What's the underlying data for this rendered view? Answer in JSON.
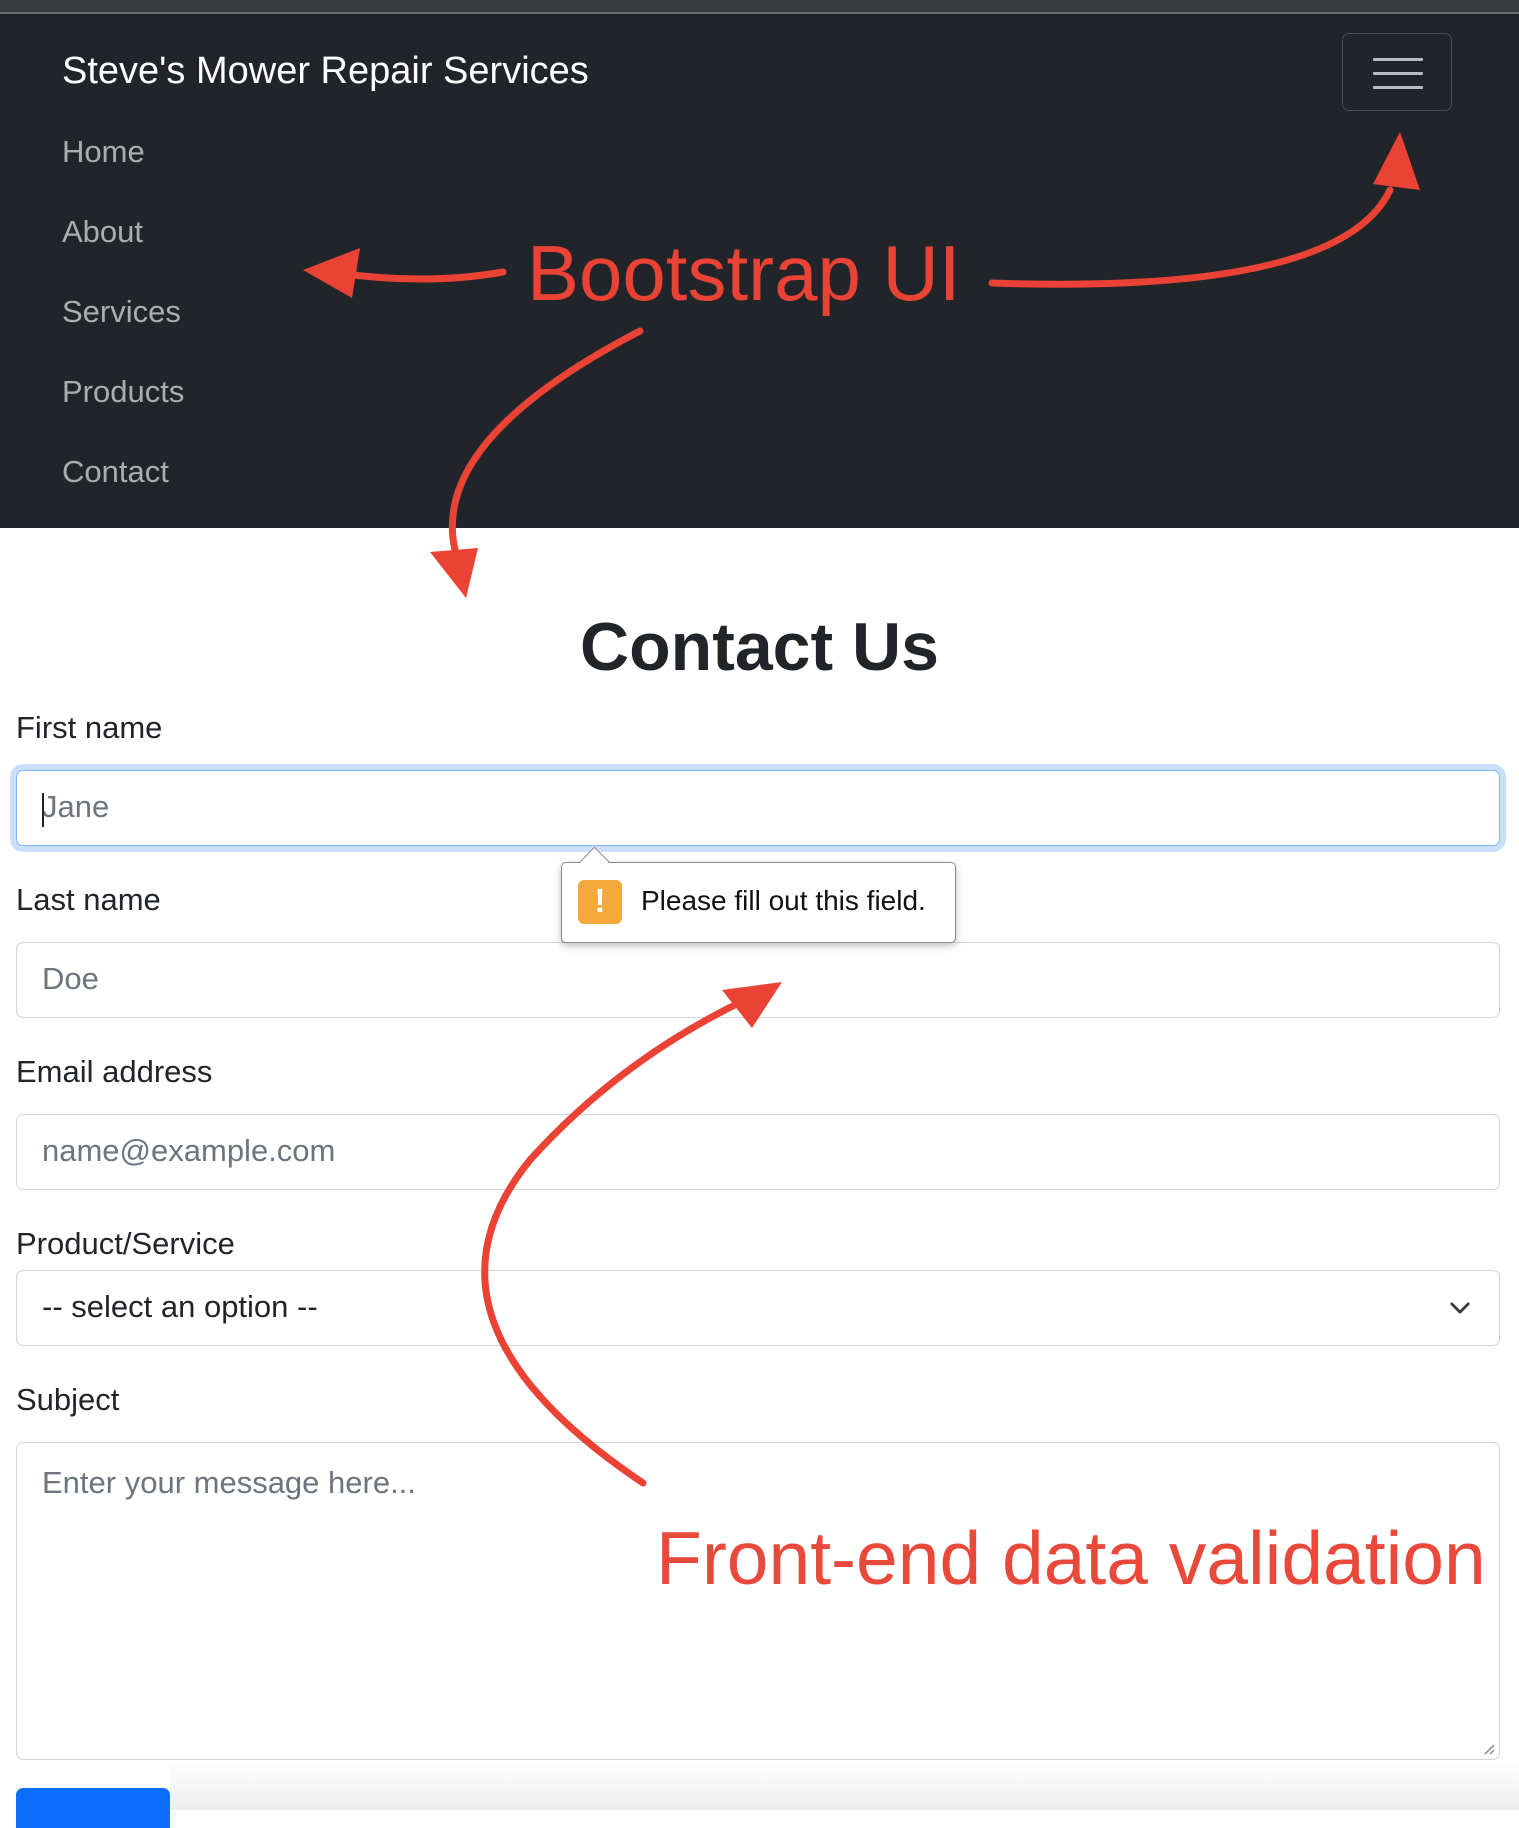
{
  "navbar": {
    "brand": "Steve's Mower Repair Services",
    "toggler_icon": "hamburger-icon",
    "items": [
      {
        "label": "Home"
      },
      {
        "label": "About"
      },
      {
        "label": "Services"
      },
      {
        "label": "Products"
      },
      {
        "label": "Contact"
      }
    ],
    "background": "#212529"
  },
  "main": {
    "title": "Contact Us",
    "form": {
      "first_name": {
        "label": "First name",
        "placeholder": "Jane",
        "value": ""
      },
      "last_name": {
        "label": "Last name",
        "placeholder": "Doe",
        "value": ""
      },
      "email": {
        "label": "Email address",
        "placeholder": "name@example.com",
        "value": ""
      },
      "product": {
        "label": "Product/Service",
        "selected": "-- select an option --"
      },
      "subject": {
        "label": "Subject",
        "placeholder": "Enter your message here..."
      },
      "validation_tooltip": {
        "message": "Please fill out this field.",
        "icon": "warning-icon"
      }
    }
  },
  "annotations": {
    "top": "Bootstrap UI",
    "bottom": "Front-end data validation",
    "color": "#ea4335"
  }
}
